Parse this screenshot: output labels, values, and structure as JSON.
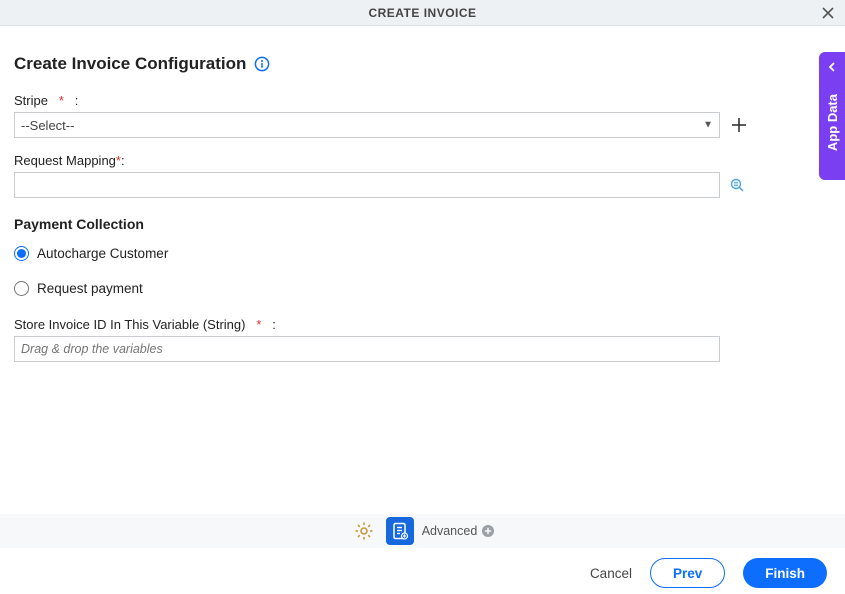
{
  "header": {
    "title": "CREATE INVOICE"
  },
  "page": {
    "title": "Create Invoice Configuration"
  },
  "fields": {
    "stripe": {
      "label": "Stripe",
      "required": "*",
      "colon": ":",
      "selected": "--Select--"
    },
    "request_mapping": {
      "label": "Request Mapping",
      "required": "*",
      "colon": ":",
      "value": ""
    },
    "payment_collection": {
      "heading": "Payment Collection",
      "option_autocharge": "Autocharge Customer",
      "option_request": "Request payment"
    },
    "store_variable": {
      "label": "Store Invoice ID In This Variable (String)",
      "required": "*",
      "colon": ":",
      "placeholder": "Drag & drop the variables"
    }
  },
  "toolbar": {
    "advanced": "Advanced"
  },
  "footer": {
    "cancel": "Cancel",
    "prev": "Prev",
    "finish": "Finish"
  },
  "side": {
    "label": "App Data"
  }
}
